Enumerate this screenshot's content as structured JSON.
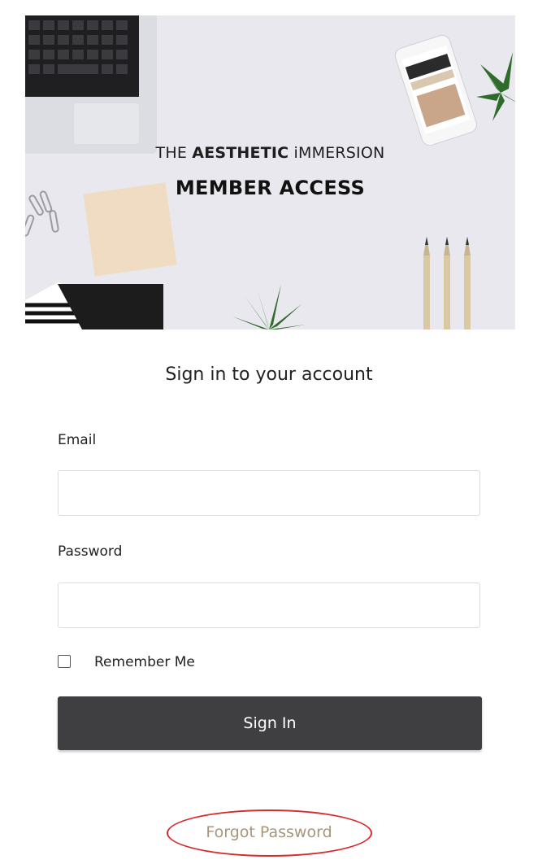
{
  "hero": {
    "line1_prefix": "THE ",
    "line1_bold": "AESTHETIC",
    "line1_suffix": " iMMERSION",
    "line2": "MEMBER ACCESS"
  },
  "form": {
    "title": "Sign in to your account",
    "email_label": "Email",
    "email_value": "",
    "password_label": "Password",
    "password_value": "",
    "remember_label": "Remember Me",
    "remember_checked": false,
    "submit_label": "Sign In",
    "forgot_label": "Forgot Password"
  },
  "colors": {
    "button_bg": "#3f3e41",
    "forgot_link": "#a8957a",
    "highlight_ellipse": "#d62b2b",
    "hero_bg": "#e9e8ee"
  }
}
